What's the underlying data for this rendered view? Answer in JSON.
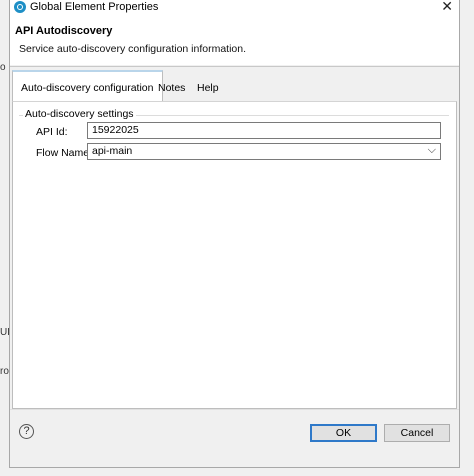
{
  "window": {
    "title": "Global Element Properties",
    "close_glyph": "✕"
  },
  "header": {
    "title": "API Autodiscovery",
    "description": "Service auto-discovery configuration information."
  },
  "tabs": [
    {
      "label": "Auto-discovery configuration",
      "active": true
    },
    {
      "label": "Notes",
      "active": false
    },
    {
      "label": "Help",
      "active": false
    }
  ],
  "settings": {
    "group_label": "Auto-discovery settings",
    "api_id_label": "API Id:",
    "api_id_value": "15922025",
    "flow_name_label": "Flow Name:",
    "flow_name_value": "api-main"
  },
  "footer": {
    "help_glyph": "?",
    "ok_label": "OK",
    "cancel_label": "Cancel"
  },
  "background_fragments": [
    "o",
    "UL",
    "ro"
  ],
  "colors": {
    "accent": "#2f79c9",
    "tab_active_top": "#b9d5ea",
    "app_icon": "#1e8fc6"
  }
}
